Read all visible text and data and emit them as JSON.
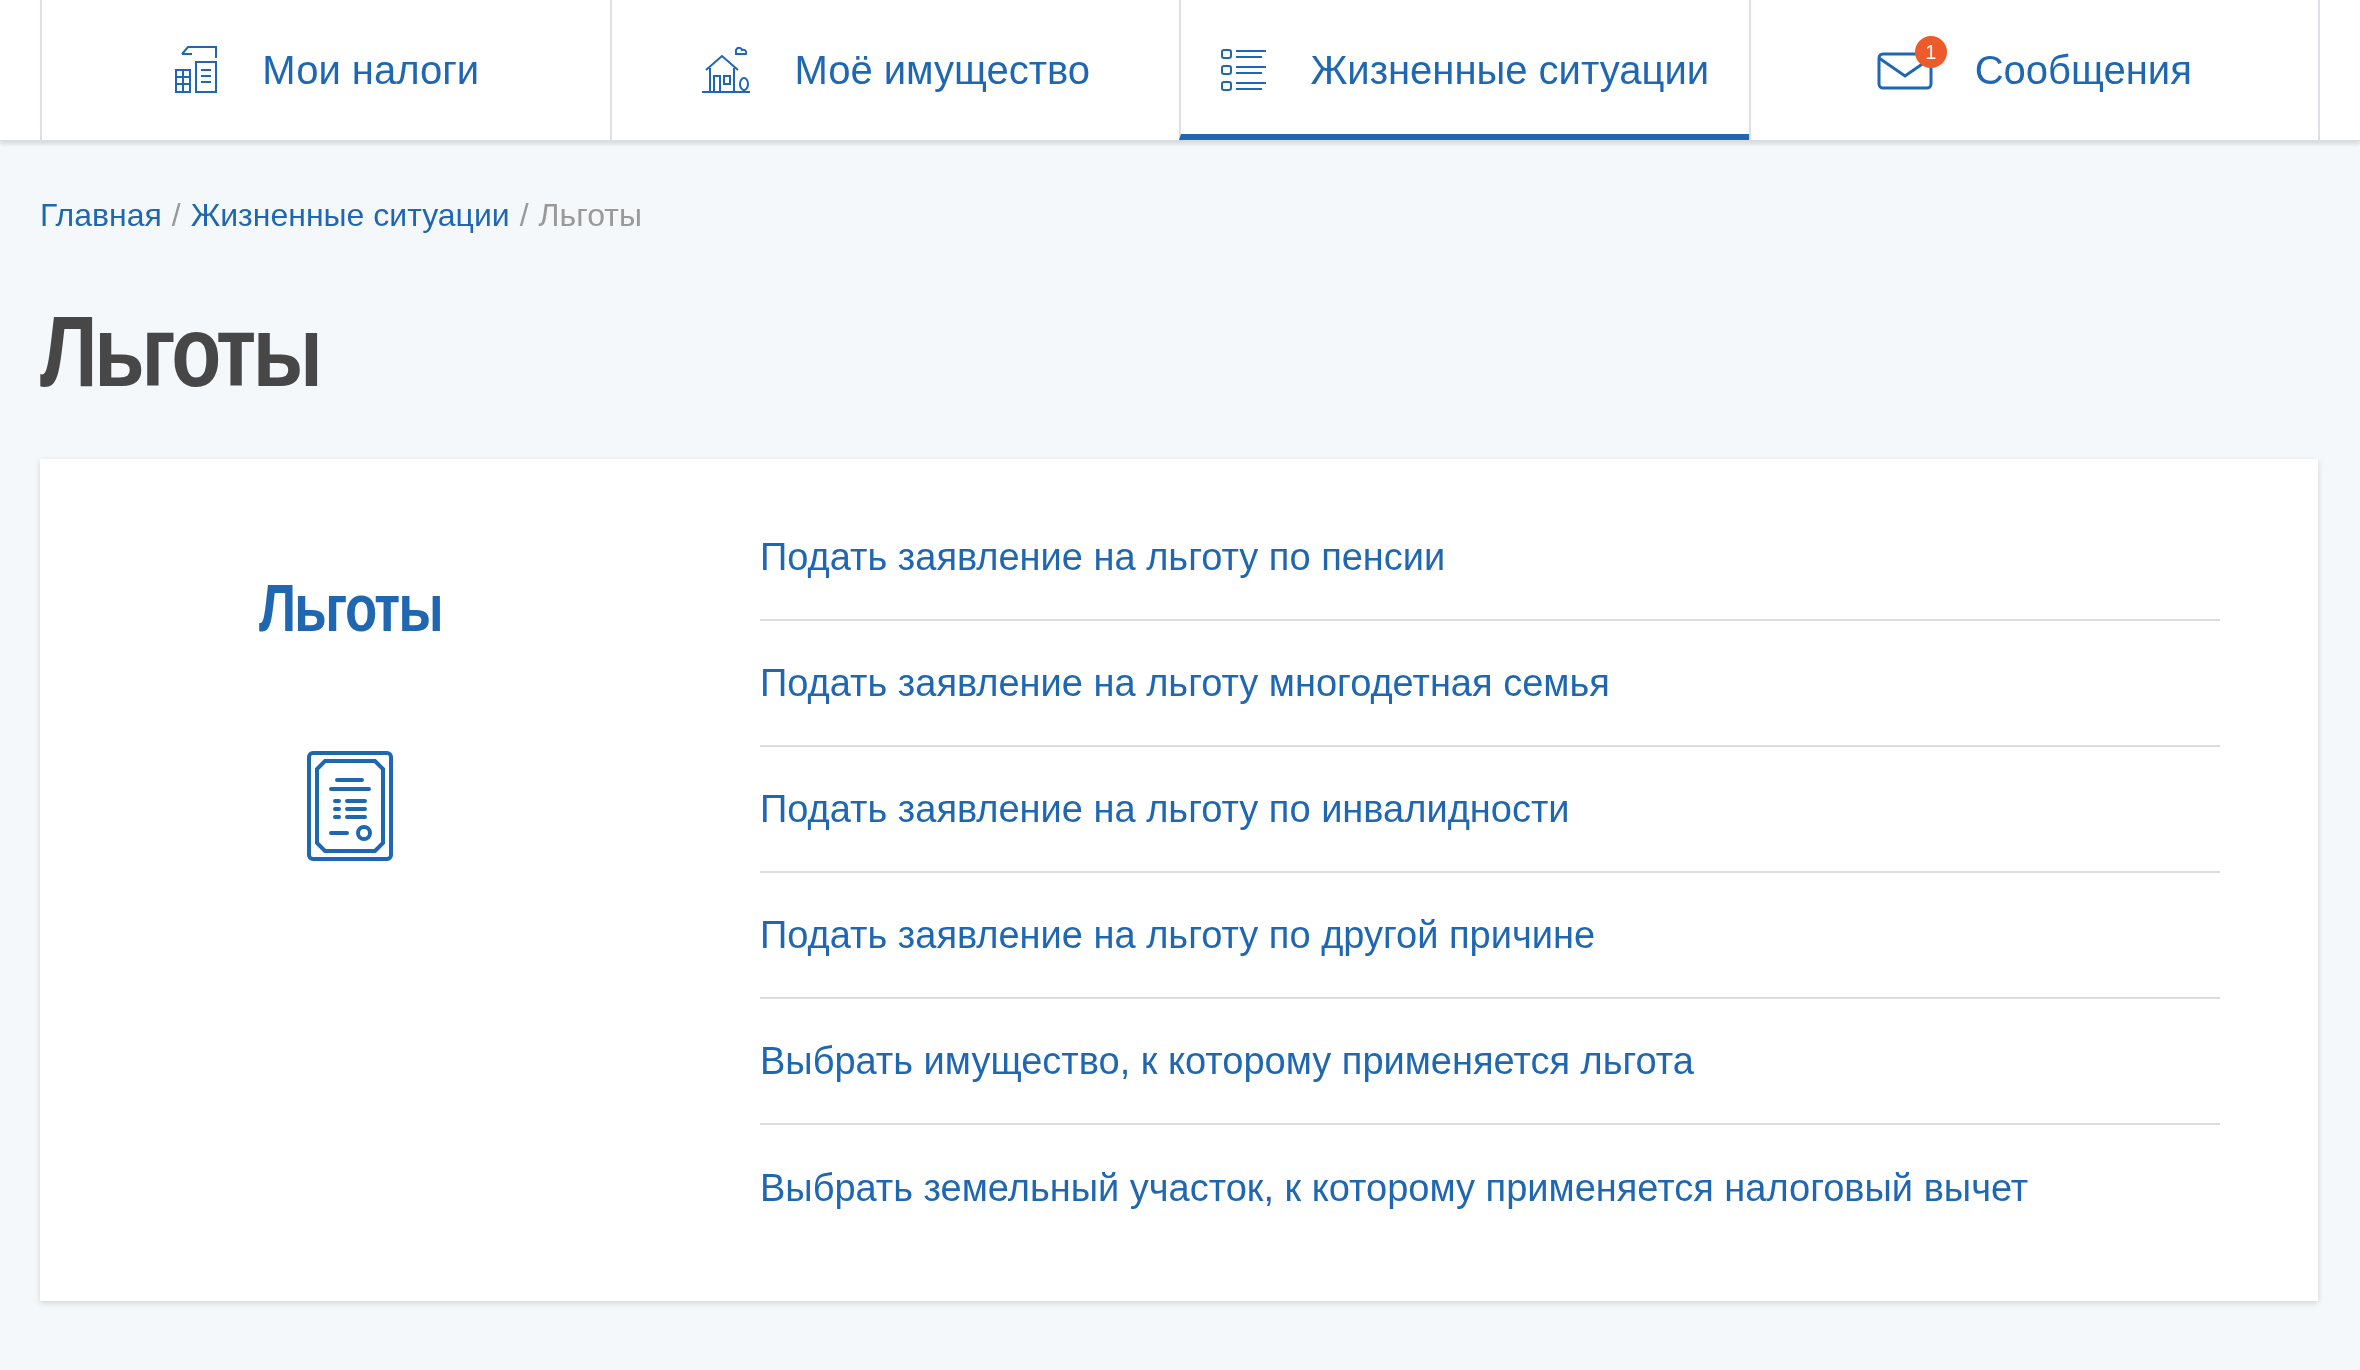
{
  "tabs": [
    {
      "label": "Мои налоги",
      "kind": "taxes",
      "selected": false
    },
    {
      "label": "Моё имущество",
      "kind": "property",
      "selected": false
    },
    {
      "label": "Жизненные ситуации",
      "kind": "list",
      "selected": true
    },
    {
      "label": "Сообщения",
      "kind": "mail",
      "selected": false,
      "badge": "1"
    }
  ],
  "breadcrumbs": [
    {
      "label": "Главная",
      "link": true
    },
    {
      "label": "Жизненные ситуации",
      "link": true
    },
    {
      "label": "Льготы",
      "link": false
    }
  ],
  "breadcrumb_separator": "/",
  "page_title": "Льготы",
  "card": {
    "title": "Льготы",
    "links": [
      "Подать заявление на льготу по пенсии",
      "Подать заявление на льготу многодетная семья",
      "Подать заявление на льготу по инвалидности",
      "Подать заявление на льготу по другой причине",
      "Выбрать имущество, к которому применяется льгота",
      "Выбрать земельный участок, к которому применяется налоговый вычет"
    ]
  }
}
